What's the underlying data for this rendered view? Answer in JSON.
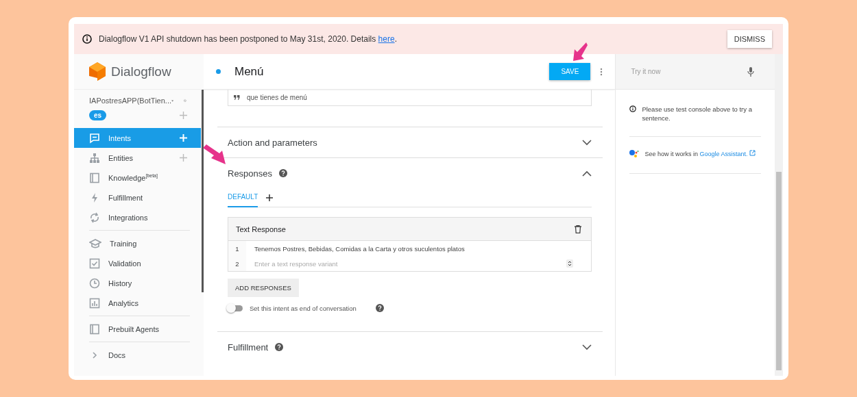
{
  "banner": {
    "message": "Dialogflow V1 API shutdown has been postponed to May 31st, 2020. Details ",
    "link": "here",
    "suffix": ".",
    "dismiss": "DISMISS"
  },
  "sidebar": {
    "logo": "Dialogflow",
    "agent": "IAPostresAPP(BotTien...",
    "language": "es",
    "groups": [
      [
        {
          "label": "Intents",
          "kind": "intents",
          "selected": true,
          "add": true
        },
        {
          "label": "Entities",
          "kind": "entities",
          "selected": false,
          "add": true
        },
        {
          "label": "Knowledge",
          "kind": "knowledge",
          "selected": false,
          "add": false,
          "tag": "[beta]"
        },
        {
          "label": "Fulfillment",
          "kind": "fulfillment",
          "selected": false,
          "add": false
        },
        {
          "label": "Integrations",
          "kind": "integrations",
          "selected": false,
          "add": false
        }
      ],
      [
        {
          "label": "Training",
          "kind": "training",
          "selected": false,
          "add": false
        },
        {
          "label": "Validation",
          "kind": "validation",
          "selected": false,
          "add": false
        },
        {
          "label": "History",
          "kind": "history",
          "selected": false,
          "add": false
        },
        {
          "label": "Analytics",
          "kind": "analytics",
          "selected": false,
          "add": false
        }
      ],
      [
        {
          "label": "Prebuilt Agents",
          "kind": "prebuilt",
          "selected": false,
          "add": false
        }
      ],
      [
        {
          "label": "Docs",
          "kind": "docs",
          "selected": false,
          "add": false
        }
      ]
    ]
  },
  "editor": {
    "title": "Menú",
    "save": "SAVE",
    "phrase": "que tienes de menú",
    "sections": [
      {
        "title": "Action and parameters",
        "expanded": false,
        "help": false
      },
      {
        "title": "Responses",
        "expanded": true,
        "help": true,
        "tabs": [
          {
            "label": "DEFAULT",
            "selected": true
          }
        ],
        "card_title": "Text Response",
        "rows": [
          {
            "number": "1",
            "value": "Tenemos Postres, Bebidas, Comidas a la Carta y otros suculentos platos"
          },
          {
            "number": "2",
            "placeholder": "Enter a text response variant"
          }
        ],
        "add_button": "ADD RESPONSES",
        "toggle": {
          "label": "Set this intent as end of conversation",
          "on": false
        }
      },
      {
        "title": "Fulfillment",
        "expanded": false,
        "help": true
      }
    ]
  },
  "test_panel": {
    "placeholder": "Try it now",
    "notice": "Please use test console above to try a sentence.",
    "assistant_text": "See how it works in ",
    "assistant_link": "Google Assistant."
  }
}
